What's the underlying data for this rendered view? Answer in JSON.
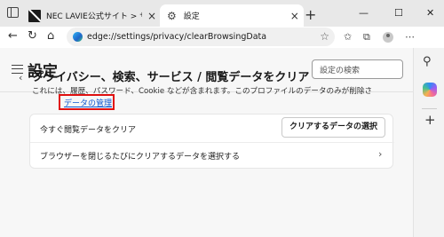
{
  "tabs": [
    {
      "title": "NEC LAVIE公式サイト > サービス＆サ"
    },
    {
      "title": "設定"
    }
  ],
  "icons": {
    "workspaces": "window-icon",
    "new_tab": "+",
    "minimize": "—",
    "maximize": "☐",
    "close": "✕",
    "tab_close": "×",
    "back": "←",
    "refresh": "↻",
    "home": "⌂",
    "star": "☆",
    "favorites": "✩",
    "extensions": "⧉",
    "more": "⋯",
    "edge_bar_search": "⚲",
    "edge_bar_add": "+",
    "chevron_left": "‹",
    "chevron_right": "›"
  },
  "address_bar": {
    "url": "edge://settings/privacy/clearBrowsingData"
  },
  "settings": {
    "title": "設定",
    "search_placeholder": "設定の検索"
  },
  "section": {
    "title": "プライバシー、検索、サービス / 閲覧データをクリア",
    "description": "これには、履歴、パスワード、Cookie などが含まれます。このプロファイルのデータのみが削除さ",
    "manage_link": "データの管理"
  },
  "rows": {
    "clear_now_label": "今すぐ閲覧データをクリア",
    "choose_button": "クリアするデータの選択",
    "on_close_label": "ブラウザーを閉じるたびにクリアするデータを選択する"
  },
  "colors": {
    "link": "#0b57d0",
    "highlight": "#e01010"
  }
}
